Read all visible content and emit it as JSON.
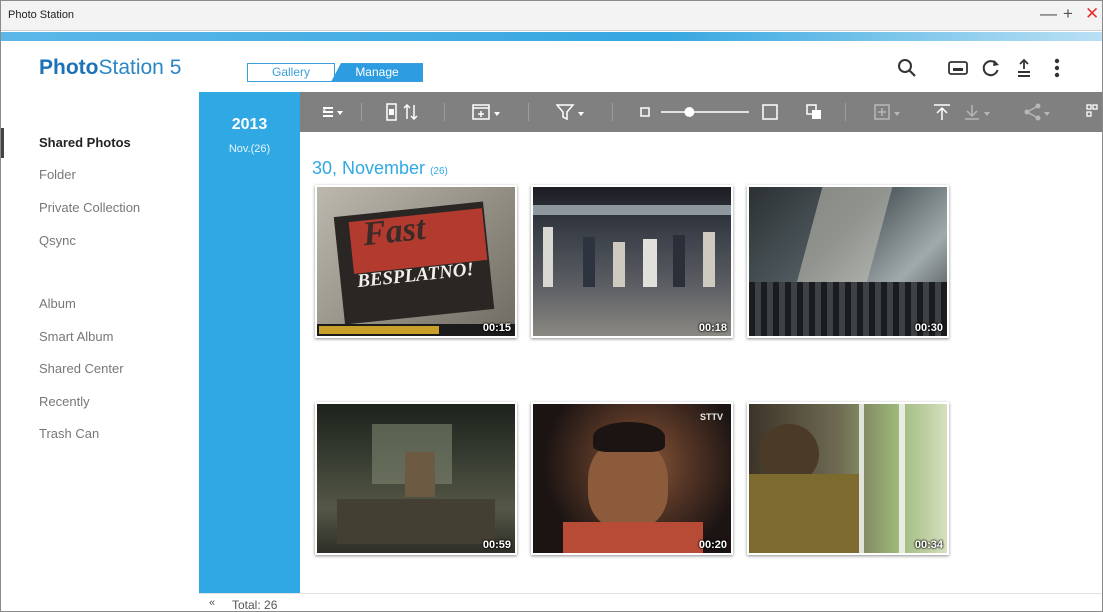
{
  "window": {
    "title": "Photo Station",
    "controls": {
      "minimize": "—",
      "maximize": "+",
      "close": "✕"
    }
  },
  "app": {
    "logo_bold": "Photo",
    "logo_rest": "Station 5"
  },
  "tabs": [
    {
      "label": "Gallery",
      "active": false
    },
    {
      "label": "Manage",
      "active": true
    }
  ],
  "header_icons": [
    "search-icon",
    "slideshow-icon",
    "refresh-icon",
    "upload-icon",
    "more-icon"
  ],
  "sidebar": {
    "items": [
      {
        "label": "Shared Photos",
        "active": true
      },
      {
        "label": "Folder"
      },
      {
        "label": "Private Collection"
      },
      {
        "label": "Qsync"
      },
      {
        "label": "Album"
      },
      {
        "label": "Smart Album"
      },
      {
        "label": "Shared Center"
      },
      {
        "label": "Recently"
      },
      {
        "label": "Trash Can"
      }
    ]
  },
  "timeline": {
    "year": "2013",
    "month": "Nov.(26)"
  },
  "toolbar": {
    "tools": [
      "view-mode-icon",
      "sort-icon",
      "select-icon",
      "filter-icon",
      "zoom-out-icon",
      "zoom-slider",
      "zoom-in-icon",
      "copy-icon",
      "add-to-album-icon",
      "upload-icon",
      "download-icon",
      "share-icon",
      "grid-icon"
    ],
    "zoom_level": 0.3
  },
  "content": {
    "date_heading": "30, November",
    "date_count": "(26)",
    "thumbnails": [
      {
        "duration": "00:15",
        "caption": "Fast",
        "caption2": "BESPLATNO!"
      },
      {
        "duration": "00:18"
      },
      {
        "duration": "00:30"
      },
      {
        "duration": "00:59"
      },
      {
        "duration": "00:20",
        "logo": "STTV"
      },
      {
        "duration": "00:34"
      }
    ]
  },
  "footer": {
    "collapse": "«",
    "total": "Total: 26"
  },
  "colors": {
    "accent": "#2fa8e4",
    "toolbar": "#808080",
    "close": "#e8322f"
  }
}
